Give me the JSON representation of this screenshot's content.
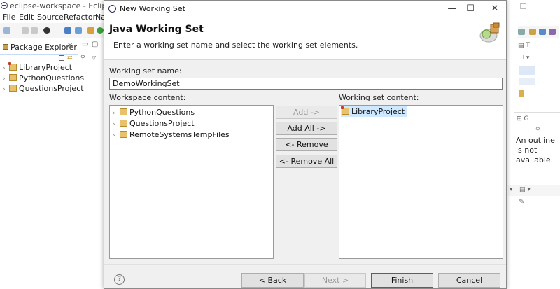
{
  "eclipse": {
    "window_title": "eclipse-workspace - Eclipse",
    "menu": [
      "File",
      "Edit",
      "Source",
      "Refactor",
      "Na"
    ],
    "package_explorer": {
      "tab_label": "Package Explorer",
      "projects": [
        "LibraryProject",
        "PythonQuestions",
        "QuestionsProject"
      ]
    },
    "outline_message": "An outline is not available."
  },
  "dialog": {
    "title": "New Working Set",
    "banner_title": "Java Working Set",
    "banner_description": "Enter a working set name and select the working set elements.",
    "name_label": "Working set name:",
    "name_value": "DemoWorkingSet",
    "workspace_content_label": "Workspace content:",
    "workspace_items": [
      "PythonQuestions",
      "QuestionsProject",
      "RemoteSystemsTempFiles"
    ],
    "working_set_content_label": "Working set content:",
    "working_set_items": [
      "LibraryProject"
    ],
    "buttons": {
      "add": "Add ->",
      "add_all": "Add All ->",
      "remove": "<- Remove",
      "remove_all": "<- Remove All",
      "back": "< Back",
      "next": "Next >",
      "finish": "Finish",
      "cancel": "Cancel"
    },
    "help_glyph": "?"
  },
  "colors": {
    "selection": "#cde8ff",
    "primary_button_border": "#0078d7",
    "project_icon": "#e8c26a"
  }
}
